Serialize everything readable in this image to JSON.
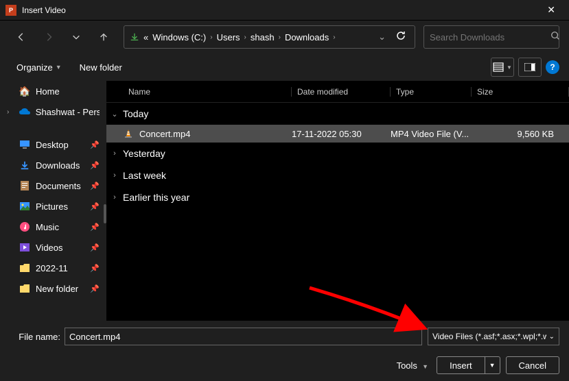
{
  "titlebar": {
    "title": "Insert Video"
  },
  "breadcrumb": {
    "prefix": "«",
    "items": [
      "Windows (C:)",
      "Users",
      "shash",
      "Downloads"
    ]
  },
  "search": {
    "placeholder": "Search Downloads"
  },
  "toolbar": {
    "organize": "Organize",
    "new_folder": "New folder"
  },
  "sidebar": {
    "home": "Home",
    "onedrive": "Shashwat - Pers",
    "items": [
      {
        "label": "Desktop",
        "icon": "desktop",
        "color": "#3794ff"
      },
      {
        "label": "Downloads",
        "icon": "down",
        "color": "#3794ff"
      },
      {
        "label": "Documents",
        "icon": "doc",
        "color": "#b58555"
      },
      {
        "label": "Pictures",
        "icon": "pic",
        "color": "#3794ff"
      },
      {
        "label": "Music",
        "icon": "music",
        "color": "#ff4e7f"
      },
      {
        "label": "Videos",
        "icon": "video",
        "color": "#7e4fdb"
      },
      {
        "label": "2022-11",
        "icon": "folder",
        "color": "#ffd86b"
      },
      {
        "label": "New folder",
        "icon": "folder",
        "color": "#ffd86b"
      }
    ]
  },
  "columns": {
    "name": "Name",
    "date": "Date modified",
    "type": "Type",
    "size": "Size"
  },
  "groups": [
    {
      "label": "Today",
      "expanded": true
    },
    {
      "label": "Yesterday",
      "expanded": false
    },
    {
      "label": "Last week",
      "expanded": false
    },
    {
      "label": "Earlier this year",
      "expanded": false
    }
  ],
  "file": {
    "name": "Concert.mp4",
    "date": "17-11-2022 05:30",
    "type": "MP4 Video File (V...",
    "size": "9,560 KB"
  },
  "bottom": {
    "filename_label": "File name:",
    "filename_value": "Concert.mp4",
    "filetype": "Video Files (*.asf;*.asx;*.wpl;*.w",
    "tools": "Tools",
    "insert": "Insert",
    "cancel": "Cancel"
  }
}
